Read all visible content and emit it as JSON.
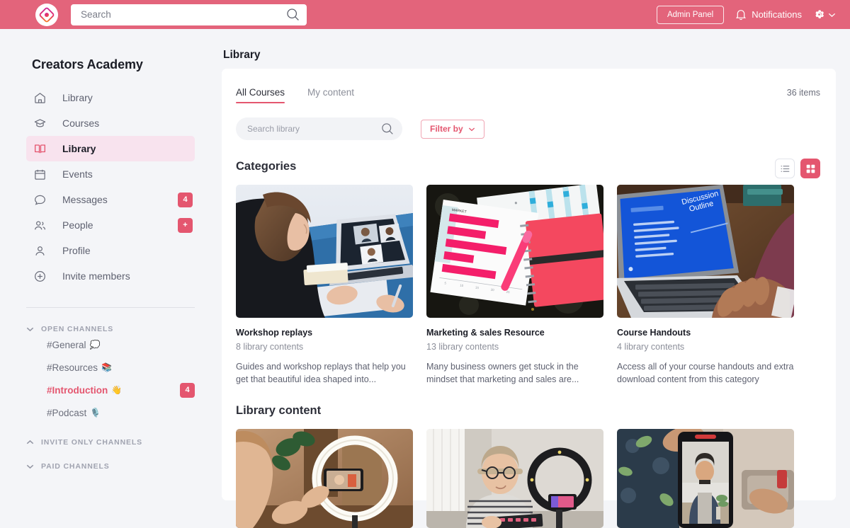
{
  "topbar": {
    "logo_icon": "diamond-logo-icon",
    "search_placeholder": "Search",
    "search_value": "",
    "search_icon": "search-icon",
    "admin_label": "Admin Panel",
    "notifications_label": "Notifications",
    "bell_icon": "bell-icon",
    "gear_icon": "gear-icon",
    "chevron_icon": "chevron-down-icon",
    "bg_color": "#E3647B"
  },
  "sidebar": {
    "brand": "Creators Academy",
    "items": [
      {
        "label": "Library",
        "icon": "home-icon",
        "badge": "",
        "active": false
      },
      {
        "label": "Courses",
        "icon": "graduation-icon",
        "badge": "",
        "active": false
      },
      {
        "label": "Library",
        "icon": "book-icon",
        "badge": "",
        "active": true
      },
      {
        "label": "Events",
        "icon": "calendar-icon",
        "badge": "",
        "active": false
      },
      {
        "label": "Messages",
        "icon": "chat-icon",
        "badge": "4",
        "active": false
      },
      {
        "label": "People",
        "icon": "people-icon",
        "badge": "+",
        "active": false
      },
      {
        "label": "Profile",
        "icon": "user-icon",
        "badge": "",
        "active": false
      },
      {
        "label": "Invite members",
        "icon": "plus-circle-icon",
        "badge": "",
        "active": false
      }
    ],
    "groups": [
      {
        "label": "OPEN CHANNELS",
        "expanded": true,
        "channels": [
          {
            "name": "#General",
            "emoji": "💭",
            "badge": "",
            "unread": false
          },
          {
            "name": "#Resources",
            "emoji": "📚",
            "badge": "",
            "unread": false
          },
          {
            "name": "#Introduction",
            "emoji": "👋",
            "badge": "4",
            "unread": true
          },
          {
            "name": "#Podcast",
            "emoji": "🎙️",
            "badge": "",
            "unread": false
          }
        ]
      },
      {
        "label": "INVITE ONLY CHANNELS",
        "expanded": false,
        "channels": []
      },
      {
        "label": "PAID CHANNELS",
        "expanded": true,
        "channels": []
      }
    ],
    "accent_active_bg": "#F8E3EE",
    "badge_color": "#E4566F"
  },
  "main": {
    "page_title": "Library",
    "tabs": [
      {
        "label": "All Courses",
        "active": true
      },
      {
        "label": "My content",
        "active": false
      }
    ],
    "items_count": "36 items",
    "search_placeholder": "Search library",
    "search_value": "",
    "filter_label": "Filter by",
    "view_list_icon": "list-view-icon",
    "view_grid_icon": "grid-view-icon",
    "active_view": "grid",
    "categories_heading": "Categories",
    "categories": [
      {
        "title": "Workshop replays",
        "count": "8 library contents",
        "description": "Guides and workshop replays that help you get that beautiful idea shaped into...",
        "image_alt": "woman-on-video-call-laptop"
      },
      {
        "title": "Marketing & sales Resource",
        "count": "13 library contents",
        "description": "Many business owners get stuck in the mindset that marketing and sales are...",
        "image_alt": "revenue-report-papers-pink-notebook"
      },
      {
        "title": "Course Handouts",
        "count": "4 library contents",
        "description": "Access all of your course handouts and extra download content from this category",
        "image_alt": "hands-typing-laptop-discussion-outline"
      }
    ],
    "library_heading": "Library content",
    "library_items": [
      {
        "image_alt": "person-filming-with-ring-light-phone"
      },
      {
        "image_alt": "man-in-beanie-recording-with-ring-light"
      },
      {
        "image_alt": "phone-recording-man-in-living-room"
      }
    ]
  }
}
